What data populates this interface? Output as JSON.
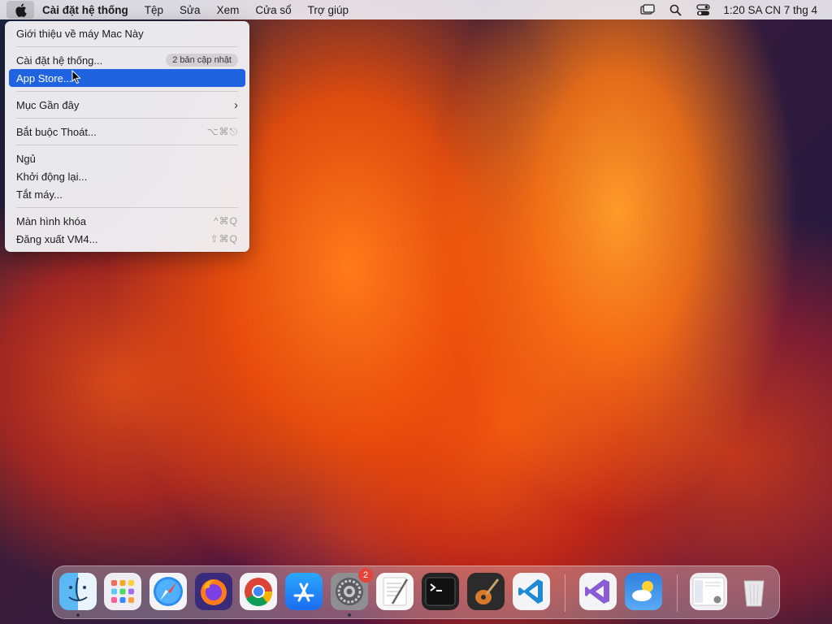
{
  "menubar": {
    "apple_icon": "apple-logo-icon",
    "app_name": "Cài đặt hệ thống",
    "menus": [
      "Tệp",
      "Sửa",
      "Xem",
      "Cửa sổ",
      "Trợ giúp"
    ],
    "status_icons": [
      "screen-mirroring-icon",
      "search-icon",
      "control-center-icon"
    ],
    "clock": "1:20 SA CN 7 thg 4"
  },
  "apple_menu": {
    "about": "Giới thiệu về máy Mac Này",
    "system_settings": "Cài đặt hệ thống...",
    "updates_badge": "2 bản cập nhật",
    "app_store": "App Store...",
    "recent_items": "Mục Gần đây",
    "force_quit": "Bắt buộc Thoát...",
    "force_quit_shortcut": "⌥⌘⎋",
    "sleep": "Ngủ",
    "restart": "Khởi động lại...",
    "shutdown": "Tắt máy...",
    "lock_screen": "Màn hình khóa",
    "lock_screen_shortcut": "^⌘Q",
    "logout": "Đăng xuất VM4...",
    "logout_shortcut": "⇧⌘Q"
  },
  "dock": {
    "apps": [
      "finder",
      "launchpad",
      "safari",
      "firefox",
      "chrome",
      "app-store",
      "system-settings",
      "textedit",
      "terminal",
      "garageband",
      "vscode",
      "visual-studio",
      "weather",
      "downloads-stack",
      "trash"
    ],
    "system_settings_badge": "2"
  },
  "colors": {
    "menu_selection": "#1f63e0",
    "badge_red": "#e5433a"
  }
}
